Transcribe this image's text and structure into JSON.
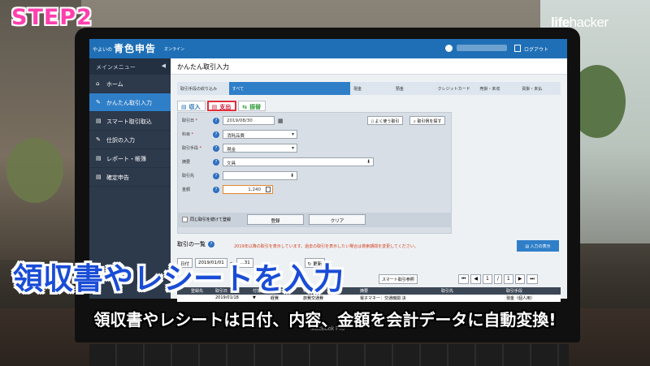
{
  "overlay": {
    "step": "STEP2",
    "logo_life": "life",
    "logo_hacker": "hacker",
    "headline": "領収書やレシートを入力",
    "caption": "領収書やレシートは日付、内容、金額を会計データに自動変換!",
    "device_label": "MacBook Pro"
  },
  "app": {
    "brand_small": "やよいの",
    "brand_main": "青色申告",
    "brand_online": "オンライン",
    "logout": "ログアウト"
  },
  "sidebar": {
    "header": "メインメニュー",
    "items": [
      {
        "label": "ホーム",
        "icon": "home-icon",
        "glyph": "⌂"
      },
      {
        "label": "かんたん取引入力",
        "icon": "pencil-icon",
        "glyph": "✎"
      },
      {
        "label": "スマート取引取込",
        "icon": "import-icon",
        "glyph": "▤"
      },
      {
        "label": "仕訳の入力",
        "icon": "journal-icon",
        "glyph": "✎"
      },
      {
        "label": "レポート・帳簿",
        "icon": "report-icon",
        "glyph": "▤"
      },
      {
        "label": "確定申告",
        "icon": "document-icon",
        "glyph": "▤"
      }
    ]
  },
  "page": {
    "title": "かんたん取引入力",
    "filter_label": "取引手段の絞り込み",
    "filters": [
      "すべて",
      "現金",
      "預金",
      "クレジットカード",
      "売掛・未収",
      "買掛・未払"
    ]
  },
  "tabs": {
    "income": "収入",
    "expense": "支出",
    "transfer": "振替"
  },
  "form": {
    "date_label": "取引日",
    "date_value": "2019/08/30",
    "favorite_button": "よく使う取引",
    "search_button": "取引例を探す",
    "category_label": "科目",
    "category_value": "消耗品費",
    "method_label": "取引手段",
    "method_value": "現金",
    "summary_label": "摘要",
    "summary_value": "文具",
    "partner_label": "取引先",
    "partner_value": "",
    "amount_label": "金額",
    "amount_value": "1,240",
    "continue_label": "同じ取引を続けて登録",
    "register_button": "登録",
    "clear_button": "クリア"
  },
  "list": {
    "title": "取引の一覧",
    "notice": "2019年以降の取引を表示しています。過去の取引を表示したい場合は検索期間を変更してください。",
    "entry_button": "入力の表示",
    "date_type": "日付",
    "date_from": "2019/01/01",
    "date_to": "～",
    "date_end": "…31",
    "update_button": "更新",
    "smart_button": "スマート取引参照",
    "page_current": "1",
    "page_sep": "/",
    "page_total": "1",
    "columns": [
      "",
      "登録先",
      "取引日",
      "付箋",
      "取引科目",
      "科目",
      "摘要",
      "取引先",
      "取引手段"
    ],
    "rows": [
      [
        "",
        "",
        "2019/01/18",
        "▼",
        "経費",
        "旅費交通費",
        "電子マネー：交通機関 決",
        "",
        "現金（個人用）"
      ]
    ]
  }
}
